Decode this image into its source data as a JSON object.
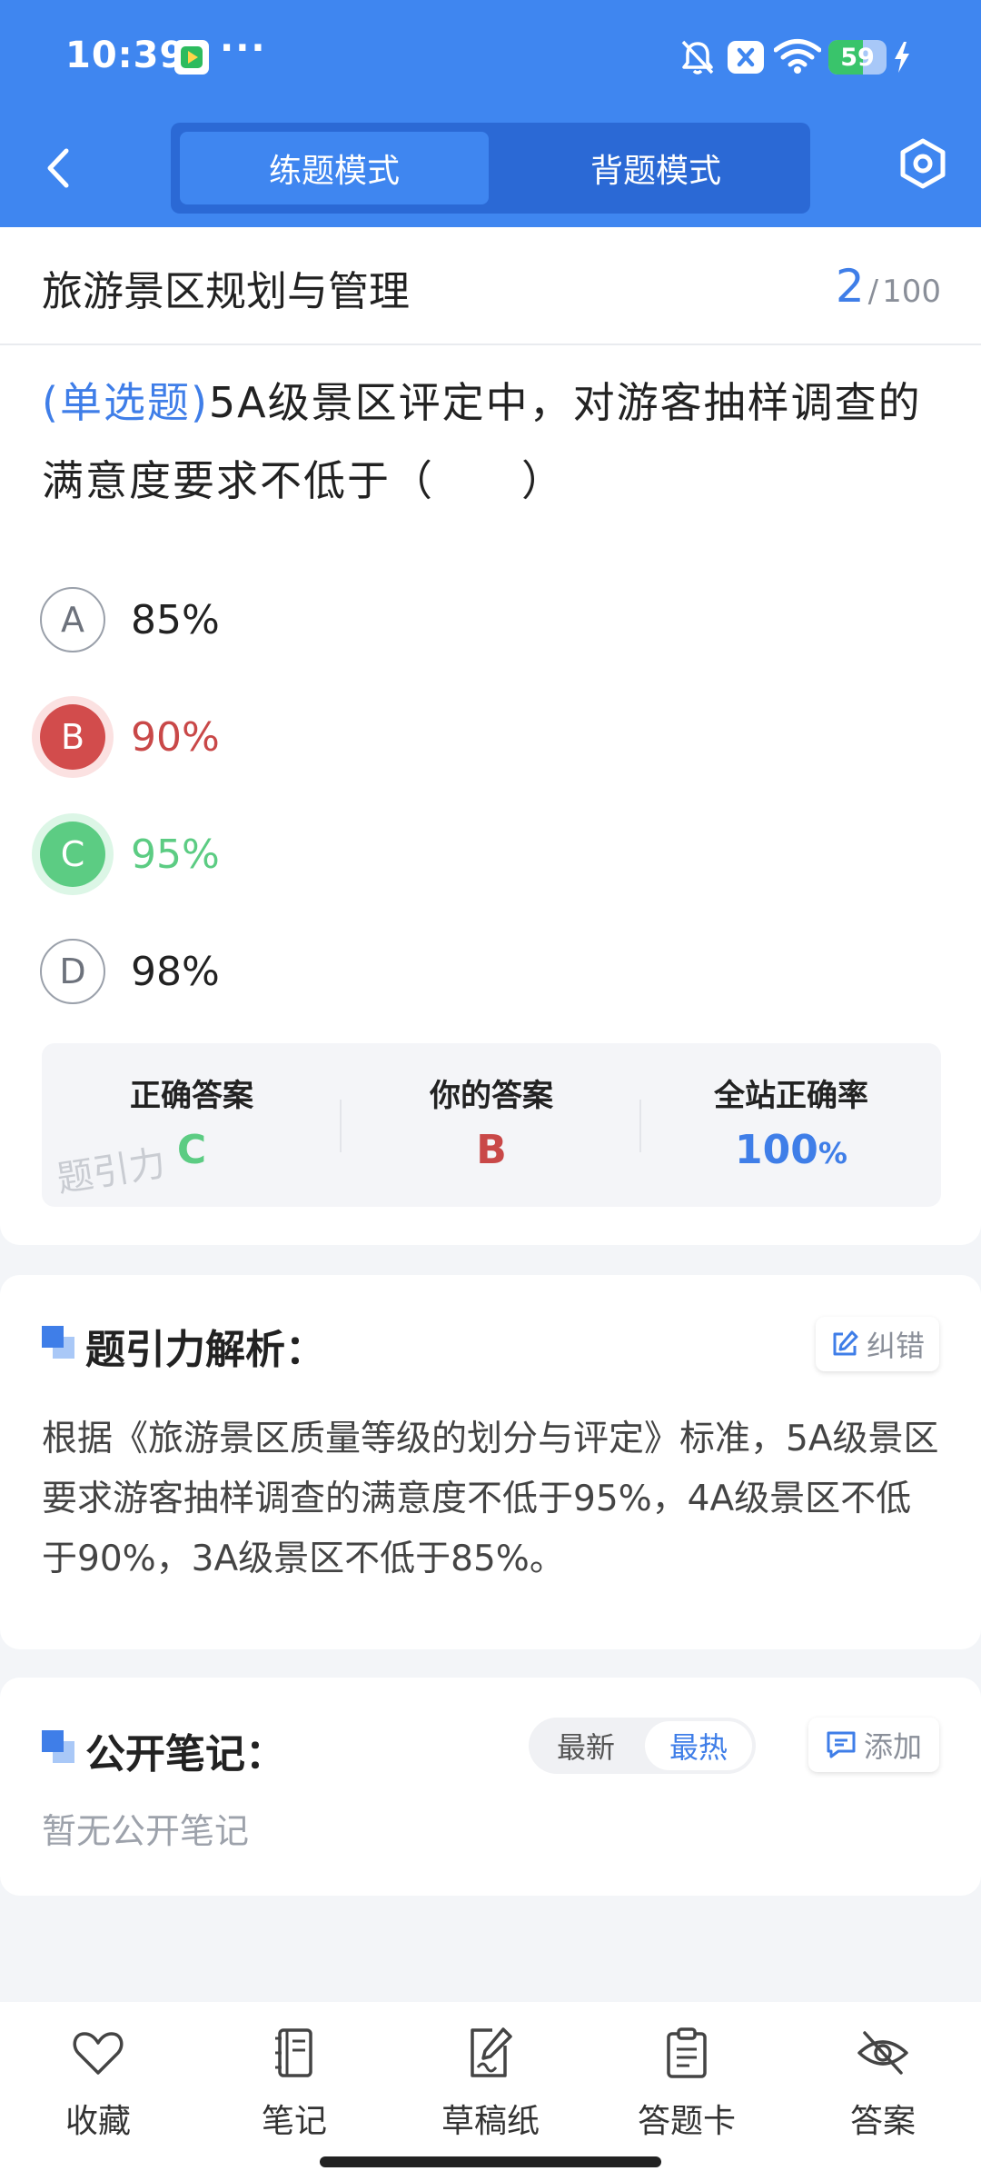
{
  "status_bar": {
    "time": "10:39",
    "dots": "···",
    "battery_level": 59,
    "battery_color": "#39c46b",
    "icons": [
      "app-icon",
      "mute-bell-icon",
      "close-notification-icon",
      "wifi-icon",
      "battery-icon",
      "charging-icon"
    ]
  },
  "nav": {
    "tabs": [
      {
        "label": "练题模式",
        "active": true
      },
      {
        "label": "背题模式",
        "active": false
      }
    ],
    "back_icon": "chevron-left-icon",
    "settings_icon": "hexagon-settings-icon"
  },
  "subject": {
    "title": "旅游景区规划与管理",
    "current": "2",
    "separator": "/",
    "total": "100"
  },
  "question": {
    "type_label": "(单选题)",
    "text": "5A级景区评定中，对游客抽样调查的满意度要求不低于（　　）"
  },
  "options": [
    {
      "letter": "A",
      "text": "85%",
      "state": "plain"
    },
    {
      "letter": "B",
      "text": "90%",
      "state": "wrong"
    },
    {
      "letter": "C",
      "text": "95%",
      "state": "right"
    },
    {
      "letter": "D",
      "text": "98%",
      "state": "plain"
    }
  ],
  "answer_summary": {
    "correct_label": "正确答案",
    "correct_value": "C",
    "yours_label": "你的答案",
    "yours_value": "B",
    "rate_label": "全站正确率",
    "rate_value": "100",
    "rate_unit": "%",
    "watermark": "题引力"
  },
  "analysis": {
    "title": "题引力解析：",
    "report_label": "纠错",
    "text": "根据《旅游景区质量等级的划分与评定》标准，5A级景区要求游客抽样调查的满意度不低于95%，4A级景区不低于90%，3A级景区不低于85%。"
  },
  "notes": {
    "title": "公开笔记：",
    "sort_options": [
      "最新",
      "最热"
    ],
    "sort_active": "最热",
    "add_label": "添加",
    "empty_text": "暂无公开笔记"
  },
  "bottom_nav": [
    {
      "label": "收藏",
      "icon": "heart-icon"
    },
    {
      "label": "笔记",
      "icon": "notebook-icon"
    },
    {
      "label": "草稿纸",
      "icon": "draft-paper-icon"
    },
    {
      "label": "答题卡",
      "icon": "answer-sheet-icon"
    },
    {
      "label": "答案",
      "icon": "eye-off-icon"
    }
  ],
  "colors": {
    "primary": "#3f86f0",
    "link_blue": "#3f7ee8",
    "correct_green": "#5ccc83",
    "wrong_red": "#d24c4c"
  }
}
